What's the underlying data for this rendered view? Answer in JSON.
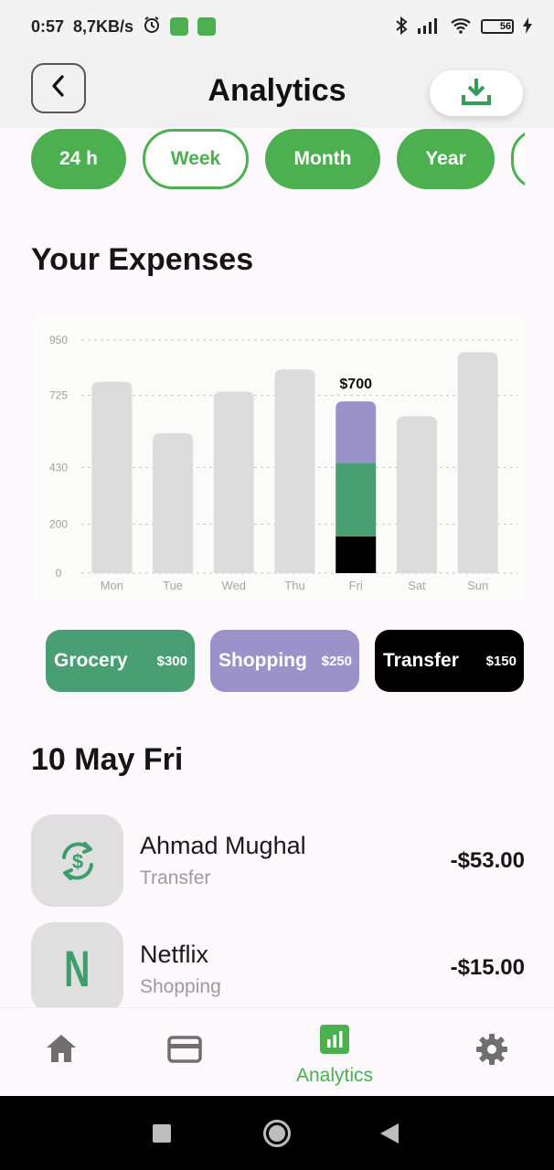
{
  "status_bar": {
    "time": "0:57",
    "net_speed": "8,7KB/s",
    "battery": "56"
  },
  "header": {
    "title": "Analytics"
  },
  "periods": [
    {
      "label": "24 h",
      "style": "solid"
    },
    {
      "label": "Week",
      "style": "outline"
    },
    {
      "label": "Month",
      "style": "solid"
    },
    {
      "label": "Year",
      "style": "solid"
    }
  ],
  "expenses": {
    "title": "Your Expenses"
  },
  "chart_data": {
    "type": "bar",
    "categories": [
      "Mon",
      "Tue",
      "Wed",
      "Thu",
      "Fri",
      "Sat",
      "Sun"
    ],
    "values": [
      780,
      570,
      740,
      830,
      700,
      640,
      900
    ],
    "highlight_index": 4,
    "highlight_label": "$700",
    "highlight_segments": [
      {
        "name": "Transfer",
        "value": 150,
        "color": "#000000"
      },
      {
        "name": "Grocery",
        "value": 300,
        "color": "#4a9e74"
      },
      {
        "name": "Shopping",
        "value": 250,
        "color": "#9b92c9"
      }
    ],
    "y_ticks": [
      0,
      200,
      430,
      725,
      950
    ],
    "ylim": [
      0,
      950
    ],
    "bar_color": "#dcdcdc",
    "grid": true
  },
  "categories_legend": [
    {
      "name": "Grocery",
      "amount": "$300",
      "color": "#4a9e74"
    },
    {
      "name": "Shopping",
      "amount": "$250",
      "color": "#9b92c9"
    },
    {
      "name": "Transfer",
      "amount": "$150",
      "color": "#000000"
    }
  ],
  "day": {
    "title": "10 May Fri"
  },
  "transactions": [
    {
      "name": "Ahmad Mughal",
      "category": "Transfer",
      "amount": "-$53.00",
      "icon": "transfer-dollar-icon"
    },
    {
      "name": "Netflix",
      "category": "Shopping",
      "amount": "-$15.00",
      "icon": "netflix-icon",
      "letter": "N"
    }
  ],
  "bottom_nav": {
    "items": [
      {
        "icon": "home-icon"
      },
      {
        "icon": "card-icon"
      },
      {
        "icon": "analytics-icon",
        "label": "Analytics",
        "active": true
      },
      {
        "icon": "settings-icon"
      }
    ]
  },
  "colors": {
    "accent": "#4caf50",
    "grocery": "#4a9e74",
    "shopping": "#9b92c9",
    "transfer": "#000000"
  }
}
